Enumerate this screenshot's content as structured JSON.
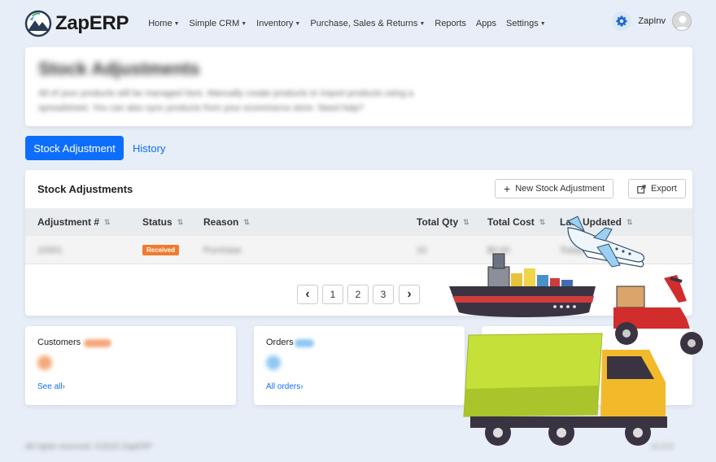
{
  "app": {
    "brand": "ZapERP"
  },
  "nav": {
    "items": [
      {
        "label": "Home",
        "dropdown": true
      },
      {
        "label": "Simple CRM",
        "dropdown": true
      },
      {
        "label": "Inventory",
        "dropdown": true
      },
      {
        "label": "Purchase, Sales & Returns",
        "dropdown": true
      },
      {
        "label": "Reports",
        "dropdown": false
      },
      {
        "label": "Apps",
        "dropdown": false
      },
      {
        "label": "Settings",
        "dropdown": true
      }
    ],
    "user_name": "ZapInv"
  },
  "page_header": {
    "title": "Stock Adjustments",
    "description": "All of your products will be managed here. Manually create products or import products using a spreadsheet. You can also sync products from your ecommerce store. Need help?"
  },
  "tabs": {
    "active": "Stock Adjustment",
    "other": "History"
  },
  "table_card": {
    "title": "Stock Adjustments",
    "new_button": "New Stock Adjustment",
    "export_button": "Export",
    "columns": [
      "Adjustment #",
      "Status",
      "Reason",
      "Total Qty",
      "Total Cost",
      "Last Updated"
    ],
    "rows": [
      {
        "number": "10001",
        "status": "Received",
        "reason": "Purchase",
        "qty": "10",
        "cost": "$0.00",
        "updated": "Today"
      }
    ],
    "pagination": {
      "prev": "‹",
      "pages": [
        "1",
        "2",
        "3"
      ],
      "next": "›"
    }
  },
  "cards": [
    {
      "title": "Customers",
      "link": "See all",
      "accent": "#f5a87a"
    },
    {
      "title": "Orders",
      "link": "All orders",
      "accent": "#8ec8f2"
    }
  ],
  "footer": {
    "left": "All rights reserved. ©2023 ZapERP",
    "right": "v1.0.0"
  },
  "colors": {
    "primary": "#0d6efd",
    "badge": "#f07b2e",
    "background": "#e8eef7"
  }
}
